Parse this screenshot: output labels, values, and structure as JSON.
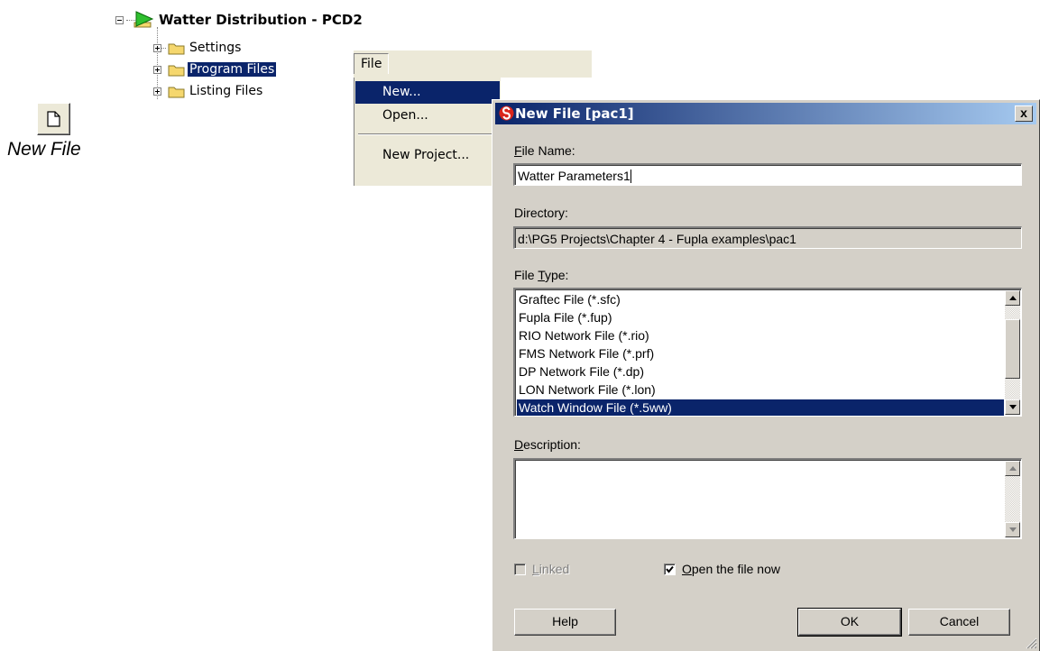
{
  "toolbar_button": {
    "caption": "New File",
    "icon": "new-file-icon"
  },
  "tree": {
    "root": {
      "label": "Watter Distribution - PCD2",
      "icon": "play-project-icon"
    },
    "items": [
      {
        "label": "Settings",
        "icon": "folder-icon",
        "selected": false
      },
      {
        "label": "Program Files",
        "icon": "folder-icon",
        "selected": true
      },
      {
        "label": "Listing Files",
        "icon": "folder-icon",
        "selected": false
      }
    ]
  },
  "menu": {
    "title": "File",
    "items": [
      {
        "label": "New...",
        "highlighted": true
      },
      {
        "label": "Open...",
        "highlighted": false
      },
      {
        "label": "New Project...",
        "highlighted": false
      }
    ]
  },
  "dialog": {
    "title": "New File [pac1]",
    "close_glyph": "x",
    "file_name": {
      "label_mnemonic": "F",
      "label_rest": "ile Name:",
      "value": "Watter Parameters1"
    },
    "directory": {
      "label": "Directory:",
      "value": "d:\\PG5 Projects\\Chapter 4 - Fupla examples\\pac1"
    },
    "file_type": {
      "label_pre": "File ",
      "label_mnemonic": "T",
      "label_rest": "ype:",
      "options": [
        "Graftec File (*.sfc)",
        "Fupla File (*.fup)",
        "RIO Network File (*.rio)",
        "FMS Network File (*.prf)",
        "DP Network File (*.dp)",
        "LON Network File (*.lon)",
        "Watch Window File (*.5ww)"
      ],
      "selected_index": 6
    },
    "description": {
      "label_mnemonic": "D",
      "label_rest": "escription:",
      "value": ""
    },
    "linked": {
      "label_mnemonic": "L",
      "label_rest": "inked",
      "checked": false,
      "enabled": false
    },
    "open_now": {
      "label_mnemonic": "O",
      "label_rest": "pen the file now",
      "checked": true
    },
    "buttons": {
      "help": "Help",
      "ok": "OK",
      "cancel": "Cancel"
    }
  },
  "colors": {
    "selection": "#0a246a",
    "dialog_face": "#d4d0c8",
    "menu_face": "#ece9d8",
    "play_icon": "#2fbf2f",
    "folder": "#f5d76e",
    "logo_red": "#d9261c"
  }
}
